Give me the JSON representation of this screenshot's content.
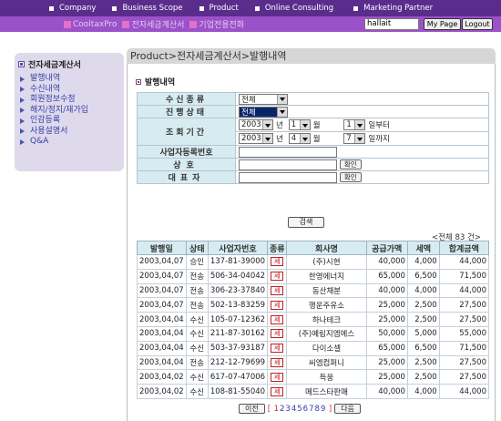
{
  "topnav": [
    "Company",
    "Business Scope",
    "Product",
    "Online Consulting",
    "Marketing Partner"
  ],
  "subnav": {
    "items": [
      "CooltaxPro",
      "전자세금계산서",
      "기업전용전화"
    ],
    "username": "hallait",
    "mypage_label": "My Page",
    "logout_label": "Logout"
  },
  "sidebar": {
    "title": "전자세금계산서",
    "items": [
      "발행내역",
      "수신내역",
      "회원정보수정",
      "해지/정지/재가입",
      "인감등록",
      "사용설명서",
      "Q&A"
    ]
  },
  "breadcrumb": "Product>전자세금계산서>발행내역",
  "section_title": "발행내역",
  "form": {
    "labels": {
      "receive_type": "수신종류",
      "status": "진행상태",
      "period": "조회기간",
      "bizno": "사업자등록번호",
      "company": "상호",
      "ceo": "대표자"
    },
    "receive_type_value": "전체",
    "status_value": "전체",
    "from": {
      "year": "2003",
      "month": "1",
      "day": "1"
    },
    "to": {
      "year": "2003",
      "month": "4",
      "day": "7"
    },
    "units": {
      "year": "년",
      "month": "월",
      "from_day": "일부터",
      "to_day": "일까지"
    },
    "confirm_label": "확인",
    "search_label": "검색"
  },
  "total_text": "<전체 83 건>",
  "table": {
    "headers": [
      "발행일",
      "상태",
      "사업자번호",
      "종류",
      "회사명",
      "공급가액",
      "세액",
      "합계금액"
    ],
    "badge": "세",
    "rows": [
      [
        "2003,04,07",
        "승인",
        "137-81-39000",
        "(주)시현",
        "40,000",
        "4,000",
        "44,000"
      ],
      [
        "2003,04,07",
        "전송",
        "506-34-04042",
        "한영에너지",
        "65,000",
        "6,500",
        "71,500"
      ],
      [
        "2003,04,07",
        "전송",
        "306-23-37840",
        "동산채분",
        "40,000",
        "4,000",
        "44,000"
      ],
      [
        "2003,04,07",
        "전송",
        "502-13-83259",
        "행운주유소",
        "25,000",
        "2,500",
        "27,500"
      ],
      [
        "2003,04,04",
        "수신",
        "105-07-12362",
        "하나테크",
        "25,000",
        "2,500",
        "27,500"
      ],
      [
        "2003,04,04",
        "수신",
        "211-87-30162",
        "(주)예림지엠에스",
        "50,000",
        "5,000",
        "55,000"
      ],
      [
        "2003,04,04",
        "수신",
        "503-37-93187",
        "다이소셀",
        "65,000",
        "6,500",
        "71,500"
      ],
      [
        "2003,04,04",
        "전송",
        "212-12-79699",
        "씨엠컴퍼니",
        "25,000",
        "2,500",
        "27,500"
      ],
      [
        "2003,04,02",
        "수신",
        "617-07-47006",
        "득웅",
        "25,000",
        "2,500",
        "27,500"
      ],
      [
        "2003,04,02",
        "수신",
        "108-81-55040",
        "메드스타판매",
        "40,000",
        "4,000",
        "44,000"
      ]
    ]
  },
  "pager": {
    "prev_label": "이전",
    "next_label": "다음",
    "open": "[",
    "close": "]",
    "pages": [
      "1",
      "2",
      "3",
      "4",
      "5",
      "6",
      "7",
      "8",
      "9"
    ],
    "current": "1"
  }
}
